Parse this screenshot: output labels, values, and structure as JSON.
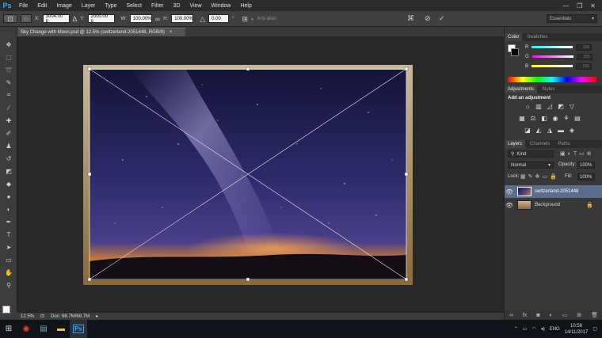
{
  "app": {
    "logo": "Ps",
    "menu": [
      "File",
      "Edit",
      "Image",
      "Layer",
      "Type",
      "Select",
      "Filter",
      "3D",
      "View",
      "Window",
      "Help"
    ],
    "window_controls": [
      "—",
      "❐",
      "✕"
    ]
  },
  "options_bar": {
    "x_label": "X:",
    "x_value": "3004.00 p",
    "y_label": "Y:",
    "y_value": "2000.00 p",
    "w_label": "W:",
    "w_value": "100.00%",
    "h_label": "H:",
    "h_value": "100.00%",
    "angle_value": "0.00",
    "antialias_label": "Anti-alias",
    "workspace": "Essentials"
  },
  "document": {
    "tab_title": "Sky Change with Moon.psd @ 12.5% (switzerland-2051448, RGB/8)",
    "tab_close": "×",
    "zoom": "12.5%",
    "doc_size": "Doc: 68.7M/68.7M"
  },
  "color_panel": {
    "tabs": [
      "Color",
      "Swatches"
    ],
    "channels": [
      {
        "label": "R",
        "value": "255",
        "color": "#e04040"
      },
      {
        "label": "G",
        "value": "255",
        "color": "#d040d0"
      },
      {
        "label": "B",
        "value": "255",
        "color": "#e0e040"
      }
    ]
  },
  "adjustments_panel": {
    "tabs": [
      "Adjustments",
      "Styles"
    ],
    "heading": "Add an adjustment",
    "icons": [
      "brightness-icon",
      "levels-icon",
      "curves-icon",
      "exposure-icon",
      "vibrance-icon",
      "hue-icon",
      "color-balance-icon",
      "bw-icon",
      "photo-filter-icon",
      "channel-mixer-icon",
      "color-lookup-icon",
      "invert-icon",
      "posterize-icon",
      "threshold-icon",
      "gradient-map-icon",
      "selective-color-icon"
    ]
  },
  "layers_panel": {
    "tabs": [
      "Layers",
      "Channels",
      "Paths"
    ],
    "kind_label": "Kind",
    "blend_mode": "Normal",
    "opacity_label": "Opacity:",
    "opacity_value": "100%",
    "lock_label": "Lock:",
    "fill_label": "Fill:",
    "fill_value": "100%",
    "layers": [
      {
        "name": "switzerland-2051448",
        "selected": true
      },
      {
        "name": "Background",
        "selected": false
      }
    ]
  },
  "taskbar": {
    "language": "ENG",
    "time": "10:56",
    "date": "14/11/2017"
  },
  "colors": {
    "accent": "#31a8ff",
    "selected_layer": "#5a6e8c"
  }
}
